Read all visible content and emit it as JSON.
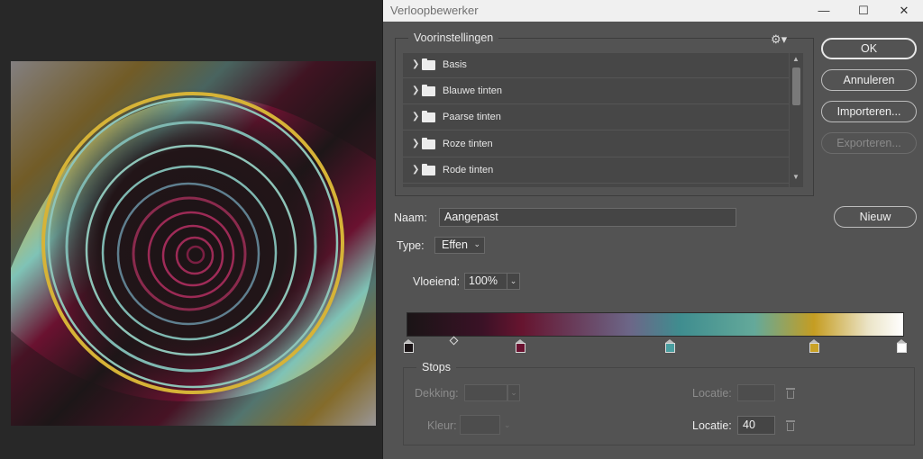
{
  "dialog": {
    "title": "Verloopbewerker"
  },
  "window_controls": {
    "minimize": "—",
    "maximize": "☐",
    "close": "✕"
  },
  "presets": {
    "legend": "Voorinstellingen",
    "gear": "⚙▾",
    "items": [
      {
        "label": "Basis"
      },
      {
        "label": "Blauwe tinten"
      },
      {
        "label": "Paarse tinten"
      },
      {
        "label": "Roze tinten"
      },
      {
        "label": "Rode tinten"
      }
    ]
  },
  "buttons": {
    "ok": "OK",
    "cancel": "Annuleren",
    "import": "Importeren...",
    "export": "Exporteren...",
    "new": "Nieuw"
  },
  "name": {
    "label": "Naam:",
    "value": "Aangepast"
  },
  "type": {
    "label": "Type:",
    "value": "Effen"
  },
  "smoothness": {
    "label": "Vloeiend:",
    "value": "100%"
  },
  "gradient": {
    "stops": [
      {
        "color": "#1a1416",
        "location": 0
      },
      {
        "color": "#6a1230",
        "location": 23
      },
      {
        "color": "#4a9ea0",
        "location": 53
      },
      {
        "color": "#c9a227",
        "location": 82
      },
      {
        "color": "#ffffff",
        "location": 100
      }
    ]
  },
  "stops_group": {
    "legend": "Stops",
    "opacity_label": "Dekking:",
    "location_label_1": "Locatie:",
    "color_label": "Kleur:",
    "location_label_2": "Locatie:",
    "location_value": "40"
  },
  "artwork": {
    "colors": [
      "#1b1416",
      "#6a1230",
      "#8ec4b8",
      "#d4a62a",
      "#ffffff"
    ]
  }
}
